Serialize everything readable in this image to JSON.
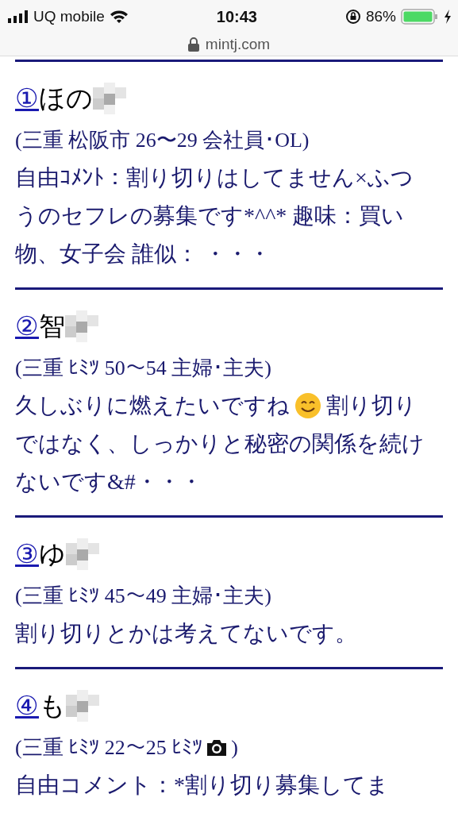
{
  "status_bar": {
    "carrier": "UQ mobile",
    "time": "10:43",
    "battery": "86%"
  },
  "address_bar": {
    "url": "mintj.com"
  },
  "entries": [
    {
      "number": "①",
      "name": "ほの",
      "profile": [
        {
          "kind": "text",
          "text": "(三重 松阪市 26〜29 会社員･OL)"
        }
      ],
      "comment_lines": [
        [
          {
            "kind": "text",
            "text": "自由ｺﾒﾝﾄ：割り切りはしてません×ふつ"
          }
        ],
        [
          {
            "kind": "text",
            "text": "うのセフレの募集です*^^* 趣味：買い"
          }
        ],
        [
          {
            "kind": "text",
            "text": "物、女子会 誰似： ・・・"
          }
        ]
      ]
    },
    {
      "number": "②",
      "name": "智",
      "profile": [
        {
          "kind": "text",
          "text": "(三重 ﾋﾐﾂ 50〜54 主婦･主夫)"
        }
      ],
      "comment_lines": [
        [
          {
            "kind": "text",
            "text": "久しぶりに燃えたいですね"
          },
          {
            "kind": "smiley"
          },
          {
            "kind": "text",
            "text": "割り切り"
          }
        ],
        [
          {
            "kind": "text",
            "text": "ではなく、しっかりと秘密の関係を続け"
          }
        ],
        [
          {
            "kind": "text",
            "text": "ないです&#・・・"
          }
        ]
      ]
    },
    {
      "number": "③",
      "name": "ゆ",
      "profile": [
        {
          "kind": "text",
          "text": "(三重 ﾋﾐﾂ 45〜49 主婦･主夫)"
        }
      ],
      "comment_lines": [
        [
          {
            "kind": "text",
            "text": "割り切りとかは考えてないです。"
          }
        ]
      ]
    },
    {
      "number": "④",
      "name": "も",
      "profile": [
        {
          "kind": "text",
          "text": "(三重 ﾋﾐﾂ 22〜25 ﾋﾐﾂ"
        },
        {
          "kind": "camera"
        },
        {
          "kind": "text",
          "text": ")"
        }
      ],
      "comment_lines": [
        [
          {
            "kind": "text",
            "text": "自由コメント：*割り切り募集してま"
          }
        ]
      ]
    }
  ]
}
